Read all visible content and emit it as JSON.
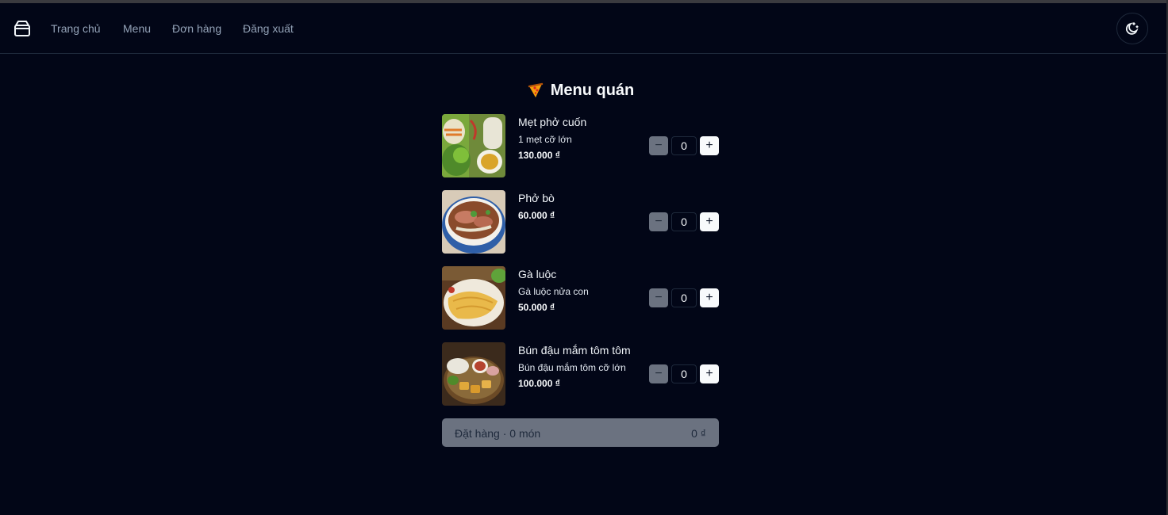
{
  "nav": {
    "links": [
      "Trang chủ",
      "Menu",
      "Đơn hàng",
      "Đăng xuất"
    ],
    "logo_icon": "box-icon",
    "theme_icon": "moon-icon"
  },
  "page": {
    "title": "Menu quán",
    "title_icon": "pizza-icon"
  },
  "menu": {
    "items": [
      {
        "name": "Mẹt phở cuốn",
        "description": "1 mẹt cỡ lớn",
        "price": "130.000 ₫",
        "quantity": "0"
      },
      {
        "name": "Phở bò",
        "description": "",
        "price": "60.000 ₫",
        "quantity": "0"
      },
      {
        "name": "Gà luộc",
        "description": "Gà luộc nửa con",
        "price": "50.000 ₫",
        "quantity": "0"
      },
      {
        "name": "Bún đậu mắm tôm tôm",
        "description": "Bún đậu mắm tôm cỡ lớn",
        "price": "100.000 ₫",
        "quantity": "0"
      }
    ],
    "minus_symbol": "−",
    "plus_symbol": "+"
  },
  "order": {
    "label": "Đặt hàng · 0 món",
    "total": "0 ₫"
  },
  "colors": {
    "background": "#020617",
    "disabled_button": "#6b7280",
    "accent_light": "#f8fafc"
  }
}
